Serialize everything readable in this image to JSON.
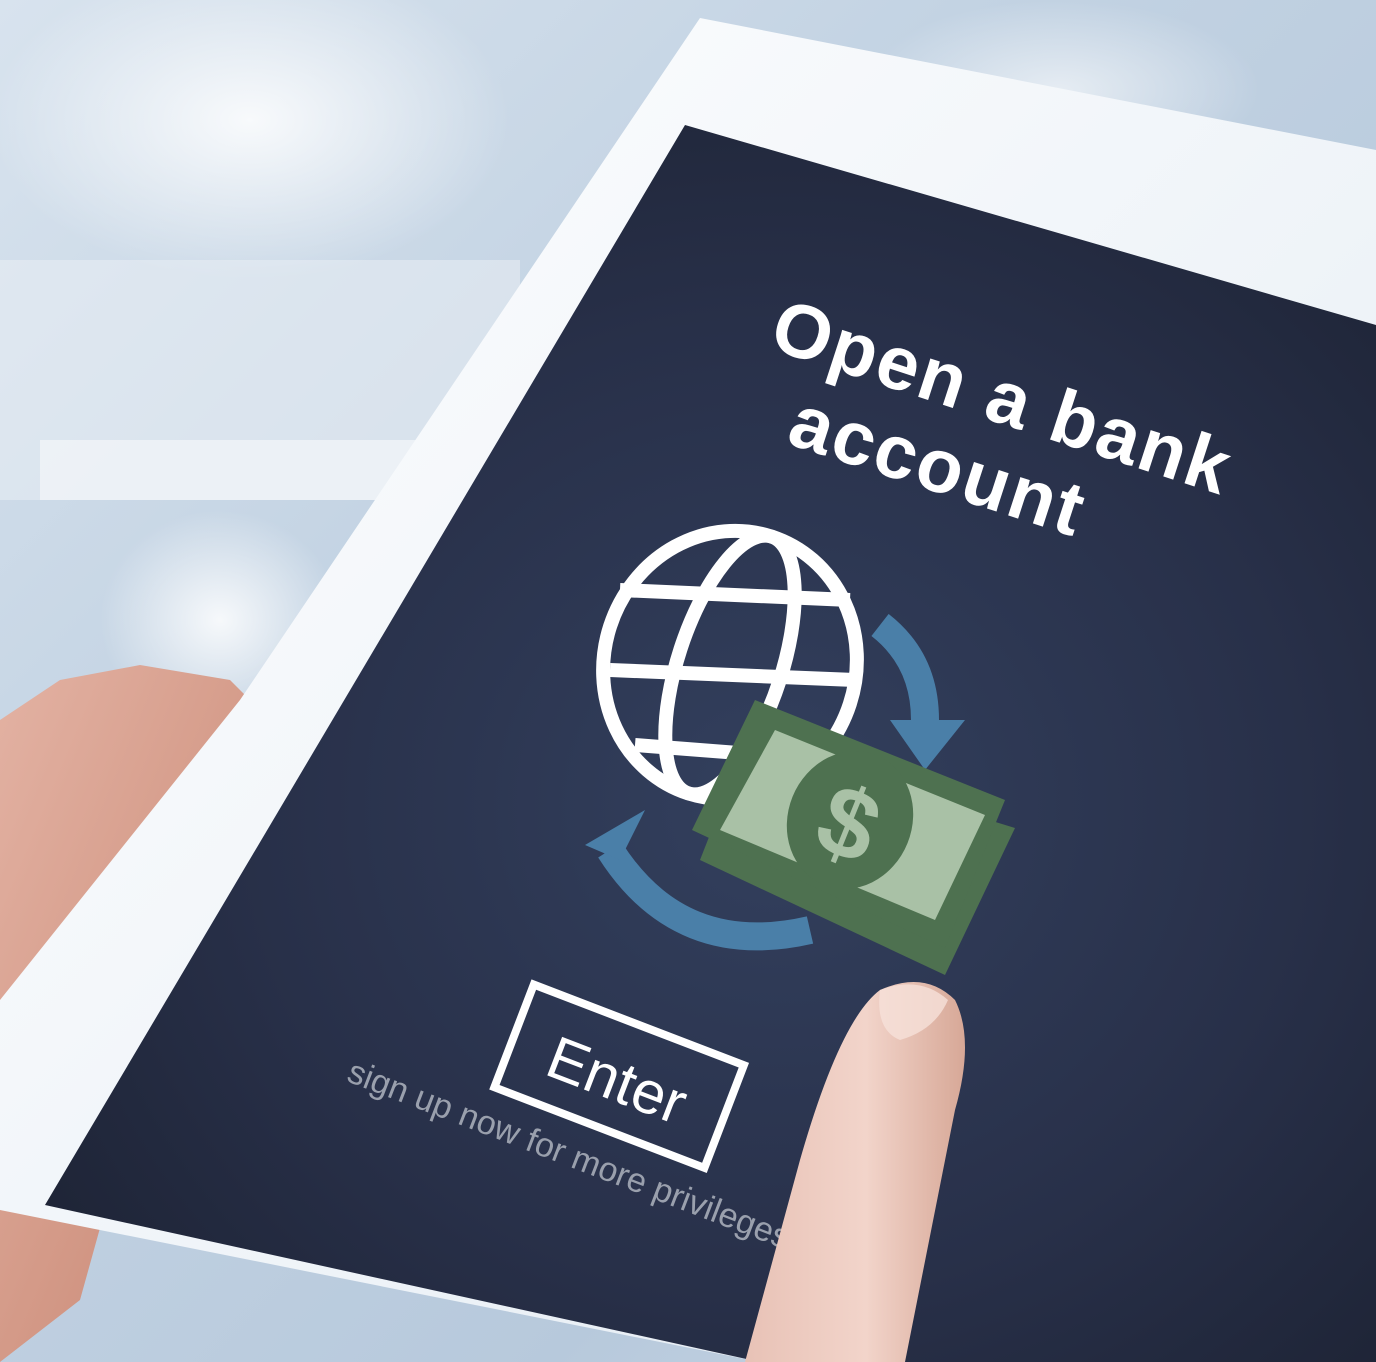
{
  "headline": {
    "line1": "Open a bank",
    "line2": "account"
  },
  "enter_button": {
    "label": "Enter"
  },
  "tagline": "sign up now for more privileges",
  "icons": [
    "globe-icon",
    "exchange-arrows-icon",
    "dollar-bill-icon"
  ],
  "colors": {
    "screen": "#2a3147",
    "headline": "#ffffff",
    "arrows": "#4a7fa8",
    "bill_dark": "#4e7150",
    "bill_light": "#a9c1a6",
    "tagline": "#9aa0ad"
  }
}
